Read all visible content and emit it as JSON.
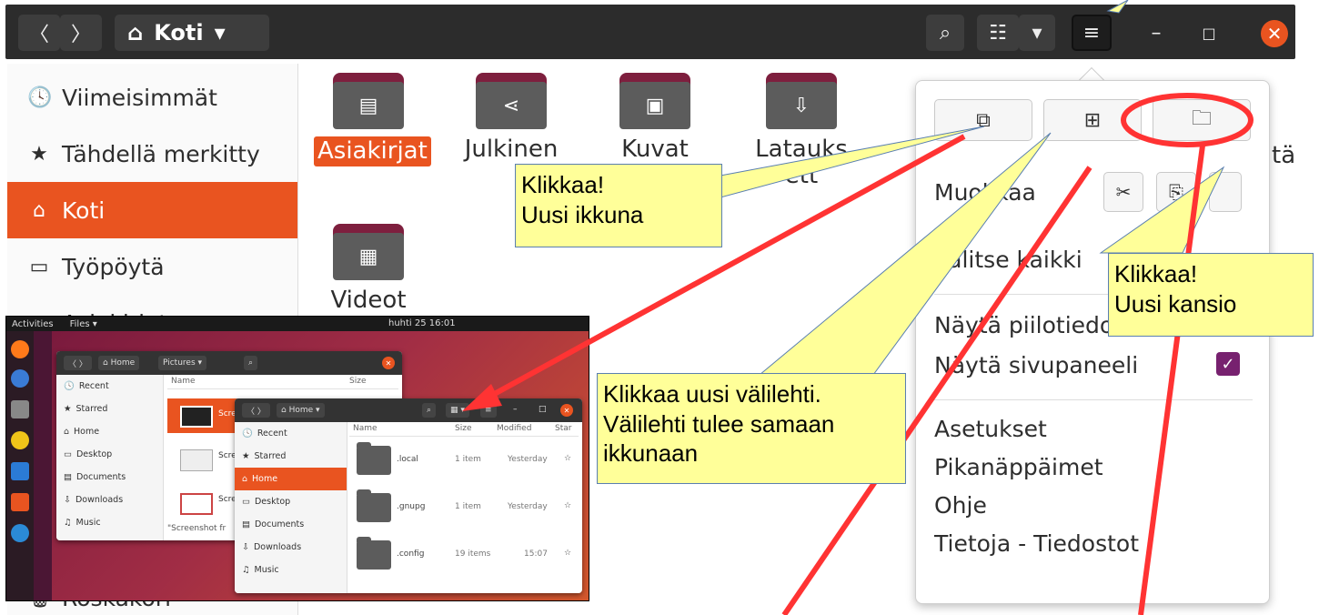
{
  "headerbar": {
    "location": "Koti",
    "back_icon": "〈",
    "forward_icon": "〉",
    "home_icon": "⌂",
    "dropdown_icon": "▾",
    "search_icon": "⌕",
    "view_icon": "☷",
    "menu_icon": "≡",
    "minimize_icon": "–",
    "maximize_icon": "□",
    "close_icon": "✕"
  },
  "sidebar": {
    "items": [
      {
        "icon": "🕓",
        "label": "Viimeisimmät"
      },
      {
        "icon": "★",
        "label": "Tähdellä merkitty"
      },
      {
        "icon": "⌂",
        "label": "Koti"
      },
      {
        "icon": "▭",
        "label": "Työpöytä"
      },
      {
        "icon": "▤",
        "label": "Asiakirjat"
      },
      {
        "icon": "🗑",
        "label": "Roskakori"
      }
    ]
  },
  "folders": [
    {
      "icon": "▤",
      "label": "Asiakirjat"
    },
    {
      "icon": "⋖",
      "label": "Julkinen"
    },
    {
      "icon": "▣",
      "label": "Kuvat"
    },
    {
      "icon": "⇩",
      "label": "Latauksett"
    },
    {
      "icon": "▦",
      "label": "Videot"
    }
  ],
  "partial_label": "tä",
  "menu": {
    "new_window_icon": "⧉",
    "new_tab_icon": "⊞",
    "new_folder_icon": "🗀",
    "edit_label": "Muokkaa",
    "cut_icon": "✂",
    "copy_icon": "⎘",
    "select_all": "Valitse kaikki",
    "show_hidden": "Näytä piilotiedostot",
    "show_sidebar": "Näytä sivupaneeli",
    "check_icon": "✓",
    "preferences": "Asetukset",
    "shortcuts": "Pikanäppäimet",
    "help": "Ohje",
    "about": "Tietoja - Tiedostot"
  },
  "callouts": {
    "new_window": [
      "Klikkaa!",
      "Uusi ikkuna"
    ],
    "new_folder": [
      "Klikkaa!",
      "Uusi kansio"
    ],
    "new_tab": [
      "Klikkaa uusi välilehti.",
      "Välilehti tulee samaan",
      "ikkunaan"
    ]
  },
  "inset": {
    "activities": "Activities",
    "files_menu": "Files ▾",
    "clock": "huhti 25  16:01",
    "back_window": {
      "path": "Home",
      "path2": "Pictures",
      "col_name": "Name",
      "col_size": "Size",
      "sidebar": [
        "Recent",
        "Starred",
        "Home",
        "Desktop",
        "Documents",
        "Downloads",
        "Music"
      ],
      "files": [
        "Scre",
        "Scre",
        "Scre"
      ],
      "status": "\"Screenshot fr"
    },
    "front_window": {
      "path": "Home",
      "sidebar": [
        {
          "icon": "🕓",
          "label": "Recent"
        },
        {
          "icon": "★",
          "label": "Starred"
        },
        {
          "icon": "⌂",
          "label": "Home"
        },
        {
          "icon": "▭",
          "label": "Desktop"
        },
        {
          "icon": "▤",
          "label": "Documents"
        },
        {
          "icon": "⇩",
          "label": "Downloads"
        },
        {
          "icon": "♫",
          "label": "Music"
        }
      ],
      "columns": [
        "Name",
        "Size",
        "Modified",
        "Star"
      ],
      "rows": [
        {
          "name": ".local",
          "size": "1 item",
          "modified": "Yesterday"
        },
        {
          "name": ".gnupg",
          "size": "1 item",
          "modified": "Yesterday"
        },
        {
          "name": ".config",
          "size": "19 items",
          "modified": "15:07"
        }
      ]
    }
  },
  "colors": {
    "accent": "#e95420",
    "callout_fill": "#ffff99",
    "arrow_red": "#ff3333",
    "folder_tab": "#7e1f3e"
  }
}
